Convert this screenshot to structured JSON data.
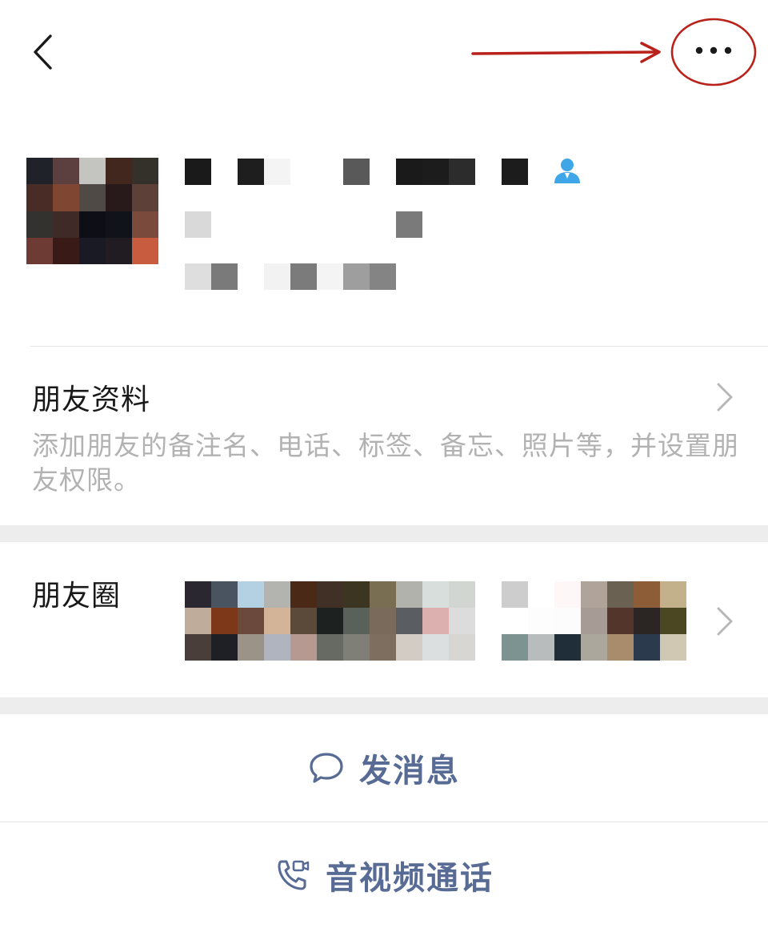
{
  "nav": {
    "back_icon": "chevron-left-icon",
    "more_icon": "ellipsis-icon",
    "annotation_color": "#b8221a"
  },
  "profile": {
    "avatar_pixels": [
      [
        "#1f2228",
        "#5c4040",
        "#c4c5c1",
        "#41271e",
        "#34302a"
      ],
      [
        "#4a2c26",
        "#7f4632",
        "#504a46",
        "#28191a",
        "#5d4139"
      ],
      [
        "#33322f",
        "#3e2a26",
        "#0d0e16",
        "#10131a",
        "#7a4a3d"
      ],
      [
        "#6d3a34",
        "#3a1a16",
        "#1a1a24",
        "#211b22",
        "#c75d3e"
      ]
    ],
    "name_pixels": [
      "#1a1a1a",
      "#ffffff",
      "#1e1e1e",
      "#f4f4f4",
      "#ffffff",
      "#ffffff",
      "#595959",
      "#ffffff",
      "#1a1a1a",
      "#1c1c1c",
      "#2c2c2c",
      "#ffffff",
      "#1c1c1c"
    ],
    "line2_pixels": [
      "#d9d9d9",
      "#ffffff",
      "#ffffff",
      "#ffffff",
      "#ffffff",
      "#ffffff",
      "#ffffff",
      "#ffffff",
      "#7a7a7a"
    ],
    "line3_pixels": [
      "#dedede",
      "#7a7a7a",
      "#ffffff",
      "#f2f2f2",
      "#7b7b7b",
      "#f4f4f4",
      "#9e9e9e",
      "#848484"
    ],
    "contact_icon": "contact-person-icon",
    "contact_icon_color": "#3fa7e8"
  },
  "friend_info": {
    "title": "朋友资料",
    "description": "添加朋友的备注名、电话、标签、备忘、照片等，并设置朋友权限。"
  },
  "moments": {
    "title": "朋友圈",
    "grid1": [
      [
        "#2a2730",
        "#4a5360",
        "#b3d1e3",
        "#b3b4b0",
        "#4a2a16",
        "#413026",
        "#3b3521",
        "#7a6e52",
        "#b2b2ad",
        "#d8dedb",
        "#d2d6d0"
      ],
      [
        "#bfac9a",
        "#7d3819",
        "#6b4a3d",
        "#d4b498",
        "#5b4a3a",
        "#1d2120",
        "#59625a",
        "#7a6a5c",
        "#5a5d61",
        "#dbb0ae",
        "#dcdcdc"
      ],
      [
        "#4a3e3a",
        "#1f1f26",
        "#9b9388",
        "#b0b4bf",
        "#b69a92",
        "#676a62",
        "#7f7f77",
        "#7d6e60",
        "#d3ccc4",
        "#dcdfe0",
        "#d8d6d2"
      ]
    ],
    "grid2": [
      [
        "#cdcdcd",
        "#ffffff",
        "#fdf8f7",
        "#b0a49a",
        "#6b6152",
        "#8d5d37",
        "#c2b18a"
      ],
      [
        "#ffffff",
        "#fdfdfd",
        "#fcfcfc",
        "#a79c95",
        "#54352c",
        "#2b2524",
        "#4b4722"
      ],
      [
        "#7c9392",
        "#b9bcbc",
        "#1f2e39",
        "#aca79c",
        "#a98c6c",
        "#2c3a4d",
        "#d0c8b2"
      ]
    ]
  },
  "actions": {
    "send_message_icon": "chat-bubble-icon",
    "send_message": "发消息",
    "call_icon": "video-call-icon",
    "call": "音视频通话",
    "accent": "#576b95"
  }
}
